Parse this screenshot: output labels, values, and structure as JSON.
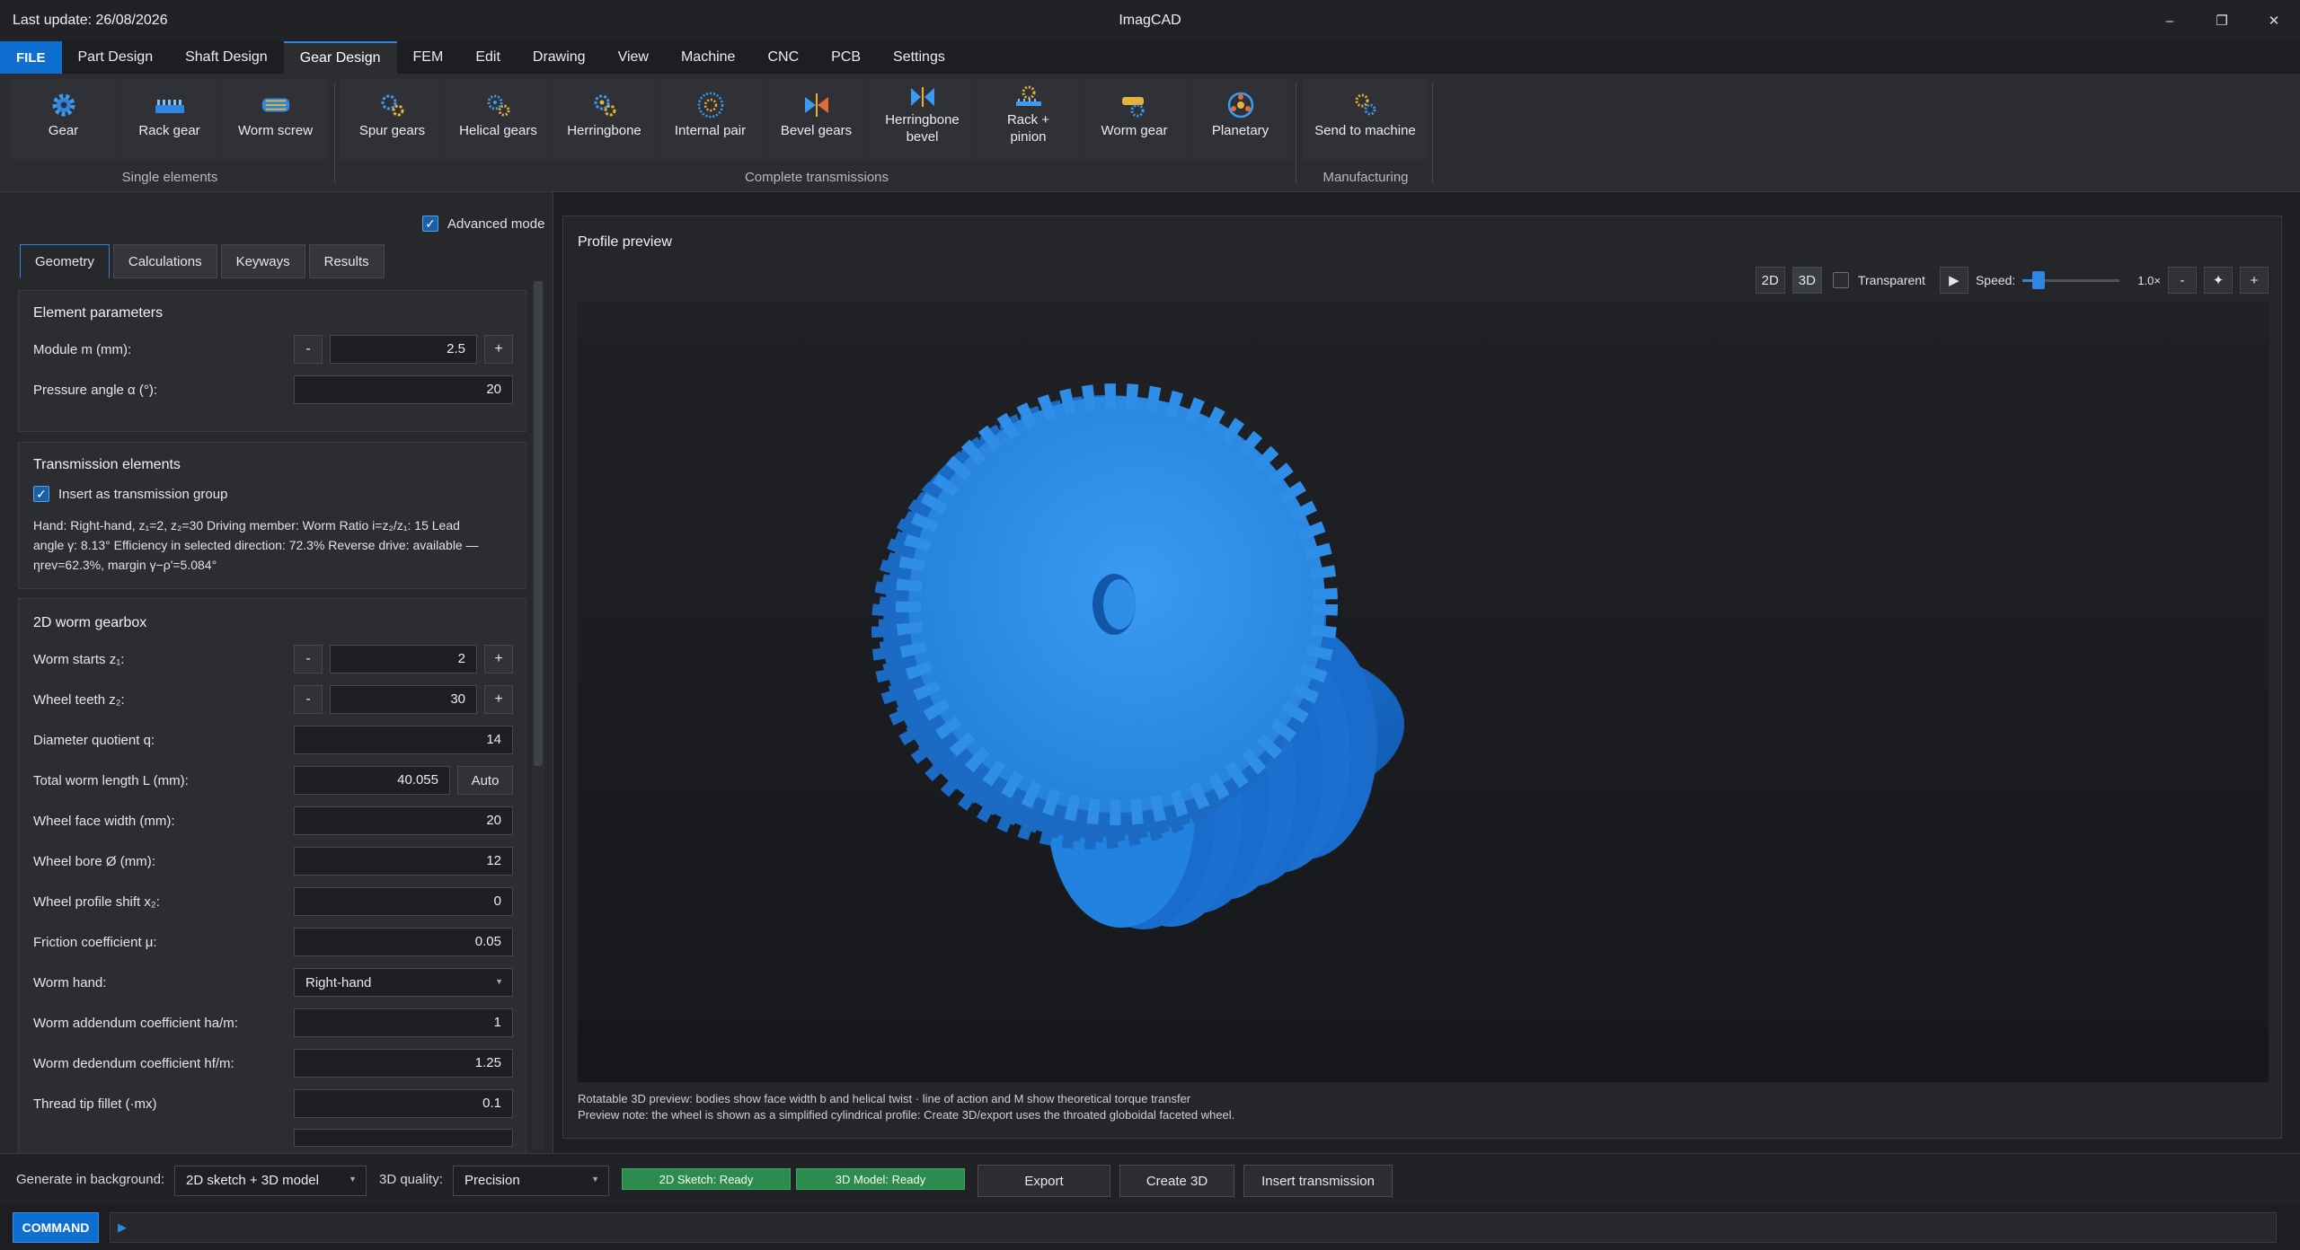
{
  "window": {
    "last_update": "Last update: 26/08/2026",
    "title": "ImagCAD",
    "minimize": "–",
    "restore": "❐",
    "close": "✕"
  },
  "menu": [
    "FILE",
    "Part Design",
    "Shaft Design",
    "Gear Design",
    "FEM",
    "Edit",
    "Drawing",
    "View",
    "Machine",
    "CNC",
    "PCB",
    "Settings"
  ],
  "ribbon": {
    "single": {
      "label": "Single elements",
      "buttons": [
        "Gear",
        "Rack gear",
        "Worm screw"
      ]
    },
    "complete": {
      "label": "Complete transmissions",
      "buttons": [
        "Spur gears",
        "Helical gears",
        "Herringbone",
        "Internal pair",
        "Bevel gears",
        "Herringbone\nbevel",
        "Rack +\npinion",
        "Worm gear",
        "Planetary"
      ]
    },
    "manufacturing": {
      "label": "Manufacturing",
      "buttons": [
        "Send to machine"
      ]
    }
  },
  "left": {
    "advanced_mode": "Advanced mode",
    "tabs": [
      "Geometry",
      "Calculations",
      "Keyways",
      "Results"
    ],
    "element_params": {
      "title": "Element parameters",
      "module_label": "Module m (mm):",
      "module_value": "2.5",
      "pressure_label": "Pressure angle α (°):",
      "pressure_value": "20"
    },
    "transmission": {
      "title": "Transmission elements",
      "insert_group": "Insert as transmission group",
      "info_1": "Hand: Right-hand, z₁=2, z₂=30 Driving member: Worm Ratio i=z₂/z₁: 15 Lead",
      "info_2": "angle γ: 8.13° Efficiency in selected direction: 72.3% Reverse drive: available —",
      "info_3": "ηrev=62.3%, margin γ−ρ'=5.084°"
    },
    "worm_gearbox": {
      "title": "2D worm gearbox",
      "rows": [
        {
          "label": "Worm starts z₁:",
          "value": "2"
        },
        {
          "label": "Wheel teeth z₂:",
          "value": "30"
        },
        {
          "label": "Diameter quotient q:",
          "value": "14"
        },
        {
          "label": "Total worm length L (mm):",
          "value": "40.055",
          "button": "Auto"
        },
        {
          "label": "Wheel face width (mm):",
          "value": "20"
        },
        {
          "label": "Wheel bore Ø (mm):",
          "value": "12"
        },
        {
          "label": "Wheel profile shift x₂:",
          "value": "0"
        },
        {
          "label": "Friction coefficient μ:",
          "value": "0.05"
        },
        {
          "label": "Worm hand:",
          "value": "Right-hand"
        },
        {
          "label": "Worm addendum coefficient ha/m:",
          "value": "1"
        },
        {
          "label": "Worm dedendum coefficient hf/m:",
          "value": "1.25"
        },
        {
          "label": "Thread tip fillet (·mx)",
          "value": "0.1"
        }
      ]
    },
    "minus": "-",
    "plus": "+"
  },
  "preview": {
    "title": "Profile preview",
    "btn_2d": "2D",
    "btn_3d": "3D",
    "transparent": "Transparent",
    "play": "▶",
    "speed_label": "Speed:",
    "speed_value": "1.0×",
    "speed_fraction": 0.12,
    "zoom_out": "-",
    "fit": "✦",
    "zoom_in": "+",
    "note_1": "Rotatable 3D preview: bodies show face width b and helical twist · line of action and M show theoretical torque transfer",
    "note_2": "Preview note: the wheel is shown as a simplified cylindrical profile: Create 3D/export uses the throated globoidal faceted wheel."
  },
  "bottom": {
    "generate_label": "Generate in background:",
    "generate_value": "2D sketch + 3D model",
    "quality_label": "3D quality:",
    "quality_value": "Precision",
    "status_2d": "2D Sketch: Ready",
    "status_3d": "3D Model: Ready",
    "export": "Export",
    "create3d": "Create 3D",
    "insert": "Insert transmission"
  },
  "command": {
    "label": "COMMAND",
    "prompt": "▶"
  },
  "colors": {
    "accent": "#0f6fd1",
    "ready": "#2e8b4e",
    "gear": "#2f86e0"
  }
}
